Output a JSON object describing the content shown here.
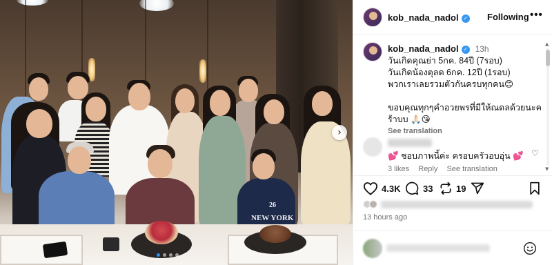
{
  "post": {
    "username": "kob_nada_nadol",
    "follow_label": "Following",
    "more_label": "•••",
    "caption": {
      "time": "13h",
      "lines": [
        "วันเกิดคุณย่า 5กค. 84ปี (7รอบ)",
        "วันเกิดน้องตุลด 6กค. 12ปี (1รอบ)",
        "พวกเราเลยรวมตัวกันครบทุกคน"
      ],
      "emoji_1": "😊",
      "thanks_line_1": "ขอบคุณทุกๆคำอวยพรที่มีให้ณดลด้วยนะค",
      "thanks_line_2": "ร้าบบ",
      "emoji_2": "🙏🏻😘",
      "see_translation": "See translation"
    },
    "comment": {
      "text": "ชอบภาพนี้ค่ะ ครอบครัวอบอุ่น",
      "emoji_heart": "💕",
      "likes": "3 likes",
      "reply": "Reply",
      "see_translation": "See translation"
    },
    "actions": {
      "likes_count": "4.3K",
      "comments_count": "33",
      "reposts_count": "19"
    },
    "timestamp": "13 hours ago",
    "media": {
      "next_arrow": "›",
      "slide_count": 4,
      "active_slide": 1,
      "cake_plaque_text": "",
      "shirt_text": "NEW YORK",
      "shirt_number": "26"
    }
  },
  "colors": {
    "verified_badge": "#3897f0",
    "active_dot": "#2e8bf0",
    "meta_gray": "#737373"
  },
  "icons": [
    "verified-badge-icon",
    "more-options-icon",
    "heart-icon",
    "comment-icon",
    "repost-icon",
    "share-icon",
    "save-icon",
    "emoji-icon",
    "carousel-next-icon"
  ]
}
